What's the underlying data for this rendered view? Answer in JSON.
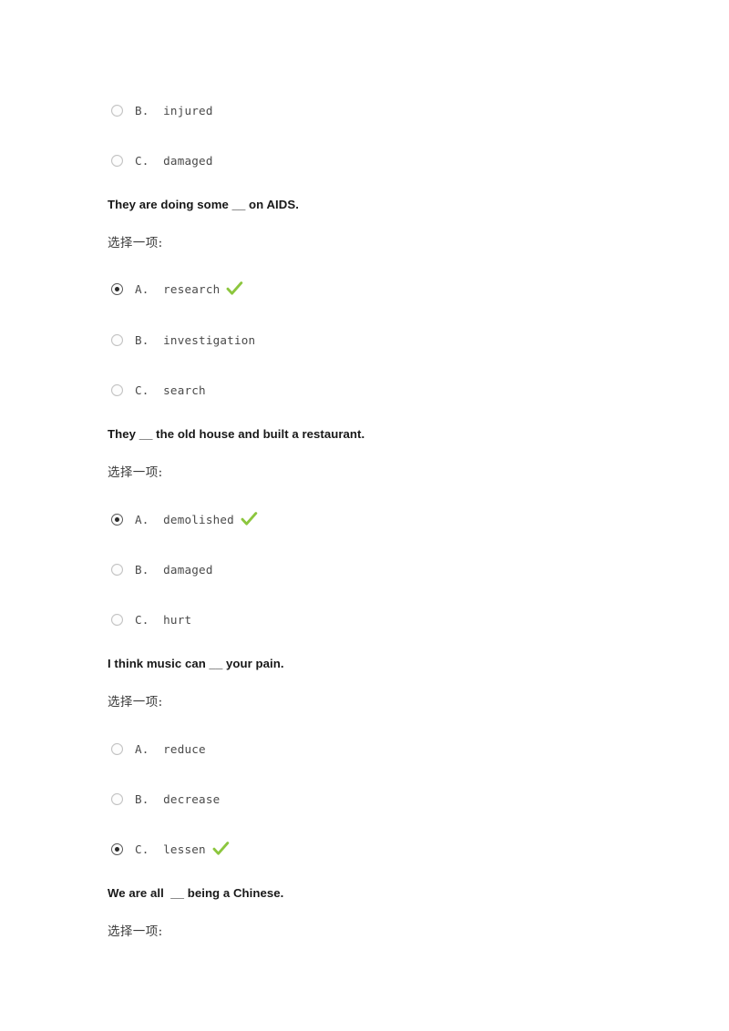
{
  "page": {
    "background_color": "#ffffff",
    "check_color": "#8CC63E",
    "radio_selected_color": "#2b2b2b",
    "radio_unselected_color": "#c2c2c2",
    "question_text_color": "#181818",
    "option_text_color": "#4a4a4a"
  },
  "choose_prompt": "选择一项:",
  "partial_question_top": {
    "options": [
      {
        "letter": "B.",
        "text": "injured",
        "label": "B.  injured",
        "selected": false,
        "correct": false
      },
      {
        "letter": "C.",
        "text": "damaged",
        "label": "C.  damaged",
        "selected": false,
        "correct": false
      }
    ]
  },
  "questions": [
    {
      "text": "They are doing some __ on AIDS.",
      "prompt": "选择一项:",
      "options": [
        {
          "letter": "A.",
          "text": "research",
          "label": "A.  research",
          "selected": true,
          "correct": true,
          "check": "check-icon"
        },
        {
          "letter": "B.",
          "text": "investigation",
          "label": "B.  investigation",
          "selected": false,
          "correct": false
        },
        {
          "letter": "C.",
          "text": "search",
          "label": "C.  search",
          "selected": false,
          "correct": false
        }
      ]
    },
    {
      "text": "They __ the old house and built a restaurant.",
      "prompt": "选择一项:",
      "options": [
        {
          "letter": "A.",
          "text": "demolished",
          "label": "A.  demolished",
          "selected": true,
          "correct": true,
          "check": "check-icon"
        },
        {
          "letter": "B.",
          "text": "damaged",
          "label": "B.  damaged",
          "selected": false,
          "correct": false
        },
        {
          "letter": "C.",
          "text": "hurt",
          "label": "C.  hurt",
          "selected": false,
          "correct": false
        }
      ]
    },
    {
      "text": "I think music can __ your pain.",
      "prompt": "选择一项:",
      "options": [
        {
          "letter": "A.",
          "text": "reduce",
          "label": "A.  reduce",
          "selected": false,
          "correct": false
        },
        {
          "letter": "B.",
          "text": "decrease",
          "label": "B.  decrease",
          "selected": false,
          "correct": false
        },
        {
          "letter": "C.",
          "text": "lessen",
          "label": "C.  lessen",
          "selected": true,
          "correct": true,
          "check": "check-icon"
        }
      ]
    },
    {
      "text": "We are all  __ being a Chinese.",
      "prompt": "选择一项:",
      "options": []
    }
  ]
}
